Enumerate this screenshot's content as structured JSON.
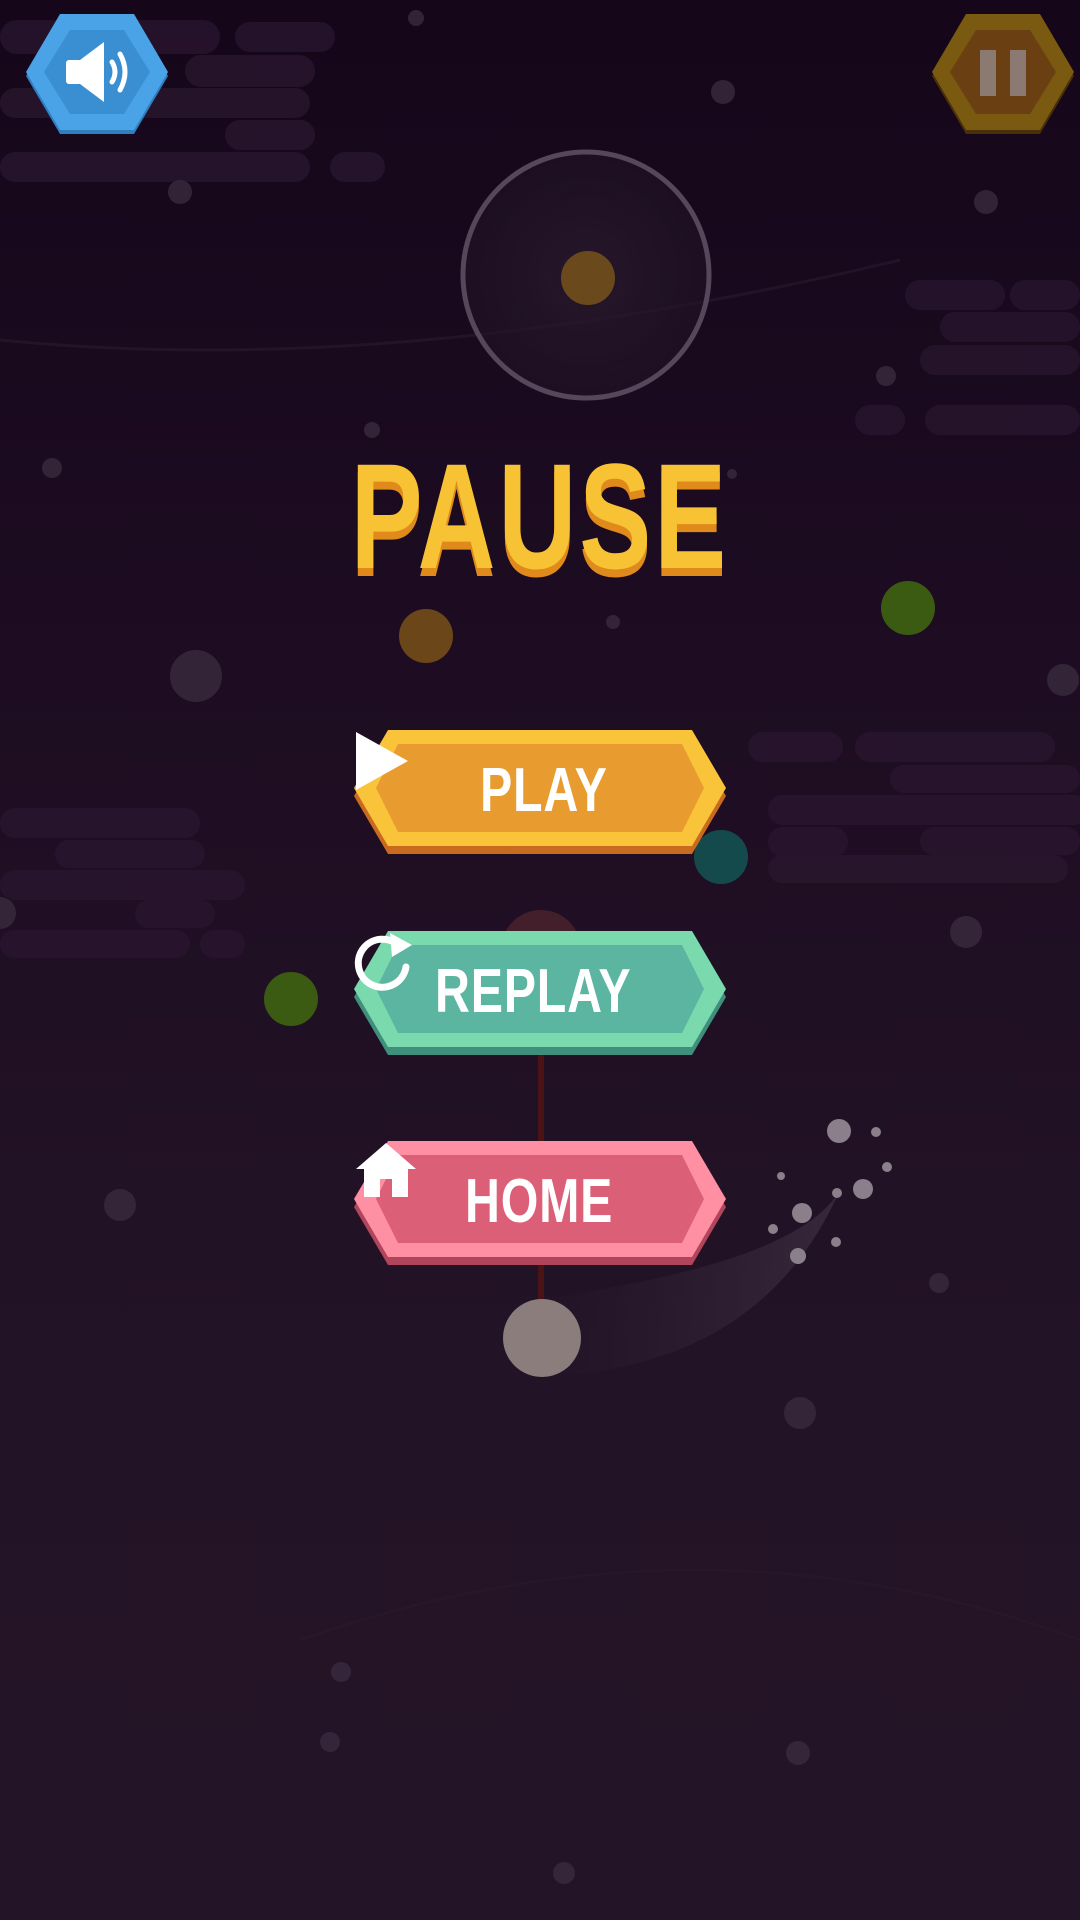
{
  "title": "PAUSE",
  "buttons": {
    "play": {
      "label": "PLAY",
      "icon": "play-icon",
      "face": "#e89b2f",
      "rim": "#f9c33a",
      "shadow": "#c86a20"
    },
    "replay": {
      "label": "REPLAY",
      "icon": "replay-icon",
      "face": "#5bb5a0",
      "rim": "#7ad9ad",
      "shadow": "#3f8f7c"
    },
    "home": {
      "label": "HOME",
      "icon": "home-icon",
      "face": "#db5f77",
      "rim": "#ff8fa3",
      "shadow": "#b0455c"
    }
  },
  "sound_button": {
    "icon": "speaker-icon",
    "color": "#4aa3e6"
  },
  "pause_button": {
    "icon": "pause-icon",
    "color": "#7a5a10"
  },
  "colors": {
    "background_top": "#15061a",
    "background_bottom": "#241427",
    "title": "#f7c233",
    "title_shadow": "#e08a1c"
  }
}
